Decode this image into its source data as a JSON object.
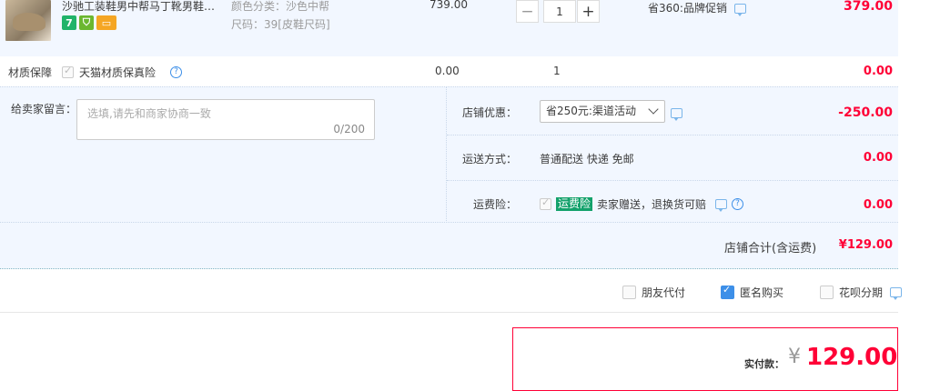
{
  "item": {
    "title": "沙驰工装鞋男中帮马丁靴男鞋秋…",
    "badges": [
      "7",
      "⛉",
      "▭"
    ],
    "spec_color": "颜色分类：沙色中帮",
    "spec_size": "尺码：39[皮鞋尺码]",
    "unit_price": "739.00",
    "quantity": "1",
    "minus": "−",
    "plus": "+",
    "promo": "省360:品牌促销",
    "subtotal": "379.00"
  },
  "material": {
    "label": "材质保障",
    "service": "天猫材质保真险",
    "price": "0.00",
    "qty": "1",
    "subtotal": "0.00"
  },
  "seller": {
    "message_label": "给卖家留言：",
    "message_placeholder": "选填,请先和商家协商一致",
    "message_count": "0/200",
    "discount_label": "店铺优惠：",
    "discount_selected": "省250元:渠道活动",
    "discount_amount": "-250.00",
    "shipping_label": "运送方式：",
    "shipping_value": "普通配送 快递 免邮",
    "shipping_amount": "0.00",
    "insurance_label": "运费险：",
    "insurance_tag": "运费险",
    "insurance_text": "卖家赠送，退换货可赔",
    "insurance_amount": "0.00"
  },
  "total": {
    "label": "店铺合计(含运费)",
    "amount": "¥129.00"
  },
  "options": {
    "friend_pay": "朋友代付",
    "anonymous": "匿名购买",
    "huabei": "花呗分期"
  },
  "payment": {
    "label": "实付款：",
    "currency": "¥",
    "amount": "129.00"
  },
  "colors": {
    "accent_red": "#ff0036",
    "panel_bg": "#f2f7ff",
    "checkbox_blue": "#3d8fe8",
    "tag_green": "#13a16b"
  }
}
